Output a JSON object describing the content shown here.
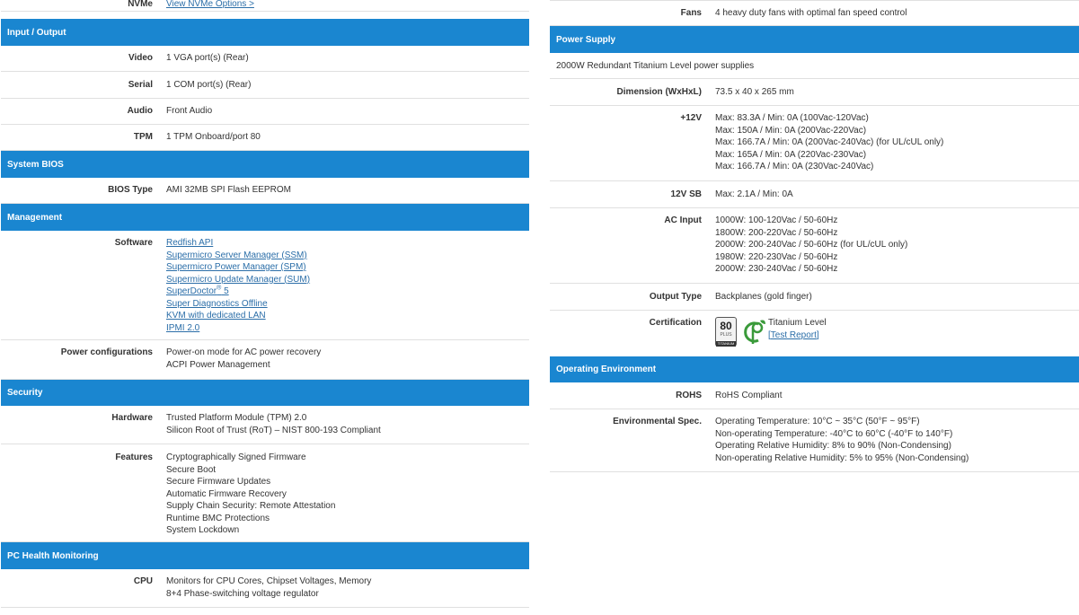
{
  "left": {
    "nvme": {
      "label": "NVMe",
      "link": "View NVMe Options >"
    },
    "io": {
      "header": "Input / Output",
      "rows": [
        {
          "label": "Video",
          "value": "1 VGA port(s) (Rear)"
        },
        {
          "label": "Serial",
          "value": "1 COM port(s) (Rear)"
        },
        {
          "label": "Audio",
          "value": "Front Audio"
        },
        {
          "label": "TPM",
          "value": "1 TPM Onboard/port 80"
        }
      ]
    },
    "bios": {
      "header": "System BIOS",
      "rows": [
        {
          "label": "BIOS Type",
          "value": "AMI 32MB SPI Flash EEPROM"
        }
      ]
    },
    "management": {
      "header": "Management",
      "software_label": "Software",
      "software_links": [
        "Redfish API",
        "Supermicro Server Manager (SSM)",
        "Supermicro Power Manager (SPM)",
        "Supermicro Update Manager (SUM)",
        "SuperDoctor",
        "Super Diagnostics Offline",
        "KVM with dedicated LAN",
        "IPMI 2.0"
      ],
      "superdoctor_sup": "®",
      "superdoctor_ver": " 5",
      "power_label": "Power configurations",
      "power_lines": [
        "Power-on mode for AC power recovery",
        "ACPI Power Management"
      ]
    },
    "security": {
      "header": "Security",
      "hardware_label": "Hardware",
      "hardware_lines": [
        "Trusted Platform Module (TPM) 2.0",
        "Silicon Root of Trust (RoT) – NIST 800-193 Compliant"
      ],
      "features_label": "Features",
      "features_lines": [
        "Cryptographically Signed Firmware",
        "Secure Boot",
        "Secure Firmware Updates",
        "Automatic Firmware Recovery",
        "Supply Chain Security: Remote Attestation",
        "Runtime BMC Protections",
        "System Lockdown"
      ]
    },
    "health": {
      "header": "PC Health Monitoring",
      "cpu_label": "CPU",
      "cpu_lines": [
        "Monitors for CPU Cores, Chipset Voltages, Memory",
        "8+4 Phase-switching voltage regulator"
      ]
    }
  },
  "right": {
    "fans": {
      "label": "Fans",
      "value": "4 heavy duty fans with optimal fan speed control"
    },
    "power": {
      "header": "Power Supply",
      "summary": "2000W Redundant Titanium Level power supplies",
      "dimension_label": "Dimension (WxHxL)",
      "dimension_value": "73.5 x 40 x 265 mm",
      "v12_label": "+12V",
      "v12_lines": [
        "Max: 83.3A / Min: 0A (100Vac-120Vac)",
        "Max: 150A / Min: 0A (200Vac-220Vac)",
        "Max: 166.7A / Min: 0A (200Vac-240Vac) (for UL/cUL only)",
        "Max: 165A / Min: 0A (220Vac-230Vac)",
        "Max: 166.7A / Min: 0A (230Vac-240Vac)"
      ],
      "sb_label": "12V SB",
      "sb_value": "Max: 2.1A / Min: 0A",
      "ac_label": "AC Input",
      "ac_lines": [
        "1000W: 100-120Vac / 50-60Hz",
        "1800W: 200-220Vac / 50-60Hz",
        "2000W: 200-240Vac / 50-60Hz (for UL/cUL only)",
        "1980W: 220-230Vac / 50-60Hz",
        "2000W: 230-240Vac / 50-60Hz"
      ],
      "output_label": "Output Type",
      "output_value": "Backplanes (gold finger)",
      "cert_label": "Certification",
      "cert_level": "Titanium Level",
      "cert_link": "[Test Report]",
      "badge_number": "80",
      "badge_plus": "PLUS",
      "badge_tier": "TITANIUM"
    },
    "env": {
      "header": "Operating Environment",
      "rohs_label": "ROHS",
      "rohs_value": "RoHS Compliant",
      "spec_label": "Environmental Spec.",
      "spec_lines": [
        "Operating Temperature: 10°C ~ 35°C (50°F ~ 95°F)",
        "Non-operating Temperature: -40°C to 60°C (-40°F to 140°F)",
        "Operating Relative Humidity: 8% to 90% (Non-Condensing)",
        "Non-operating Relative Humidity: 5% to 95% (Non-Condensing)"
      ]
    }
  },
  "colors": {
    "header_bg": "#1a86d0",
    "link": "#2b6ea8",
    "divider": "#e0e0e0"
  }
}
